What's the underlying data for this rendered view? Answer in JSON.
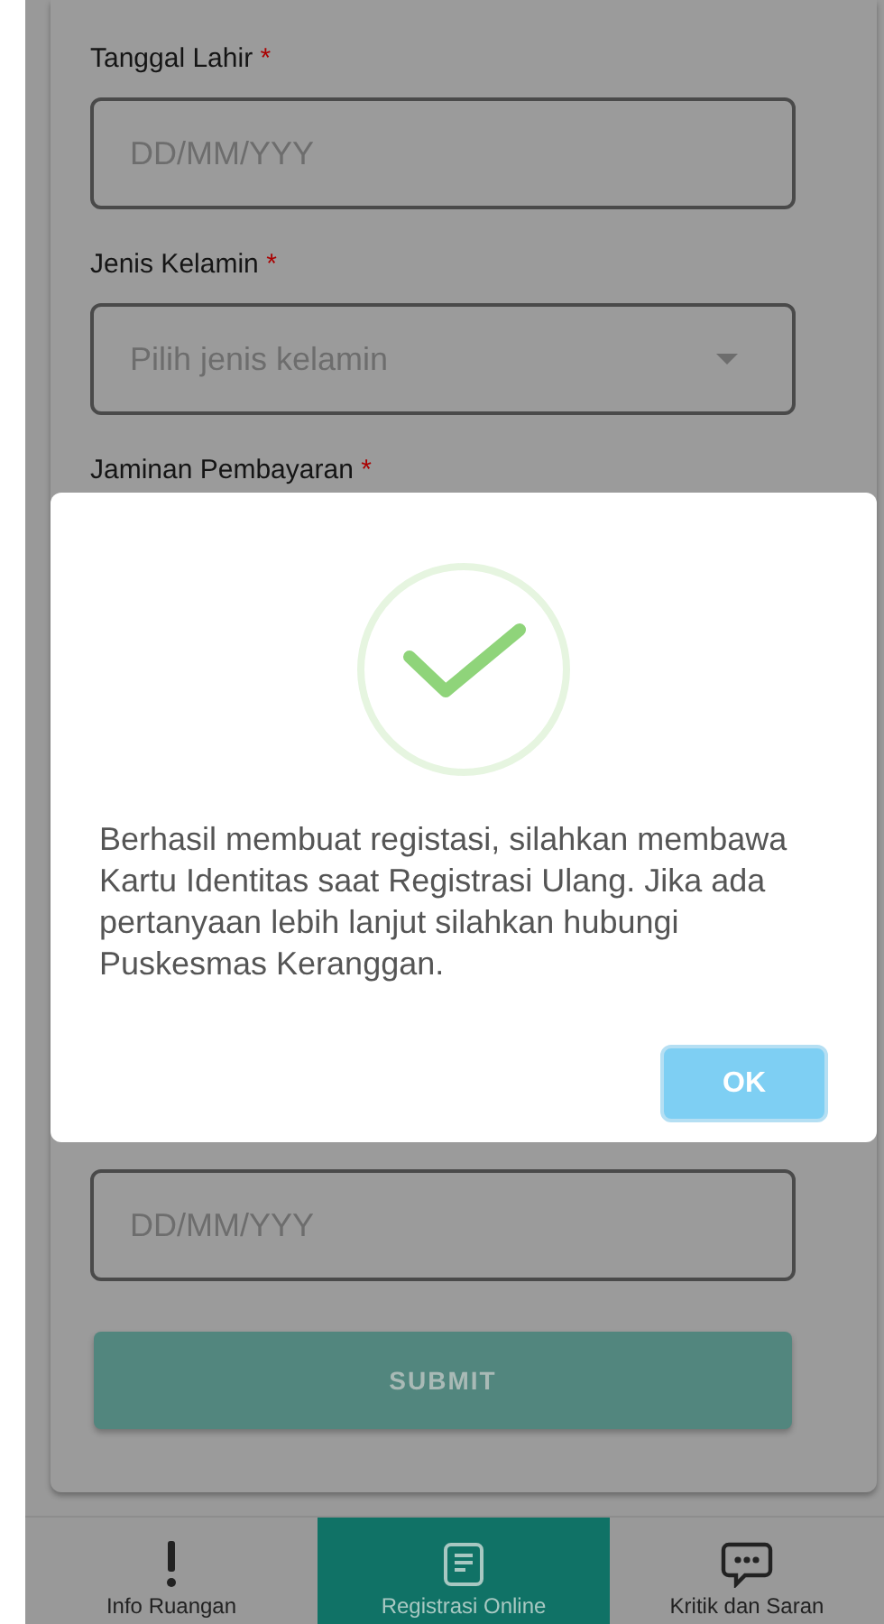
{
  "form": {
    "fields": [
      {
        "label": "Tanggal Lahir",
        "required_mark": "*",
        "kind": "date",
        "placeholder": "DD/MM/YYY"
      },
      {
        "label": "Jenis Kelamin",
        "required_mark": "*",
        "kind": "select",
        "placeholder": "Pilih jenis kelamin"
      },
      {
        "label": "Jaminan Pembayaran",
        "required_mark": "*",
        "kind": "hidden"
      },
      {
        "kind": "date",
        "placeholder": "DD/MM/YYY"
      }
    ],
    "submit": {
      "label": "SUBMIT",
      "disabled": true
    }
  },
  "dialog": {
    "message": "Berhasil membuat registasi, silahkan membawa Kartu Identitas saat Registrasi Ulang. Jika ada pertanyaan lebih lanjut silahkan hubungi Puskesmas Keranggan.",
    "button": "OK"
  },
  "nav": [
    {
      "label": "Info Ruangan",
      "kind": "info",
      "selected": false
    },
    {
      "label": "Registrasi Online",
      "kind": "registration",
      "selected": true
    },
    {
      "label": "Kritik dan Saran",
      "kind": "feedback",
      "selected": false
    }
  ]
}
